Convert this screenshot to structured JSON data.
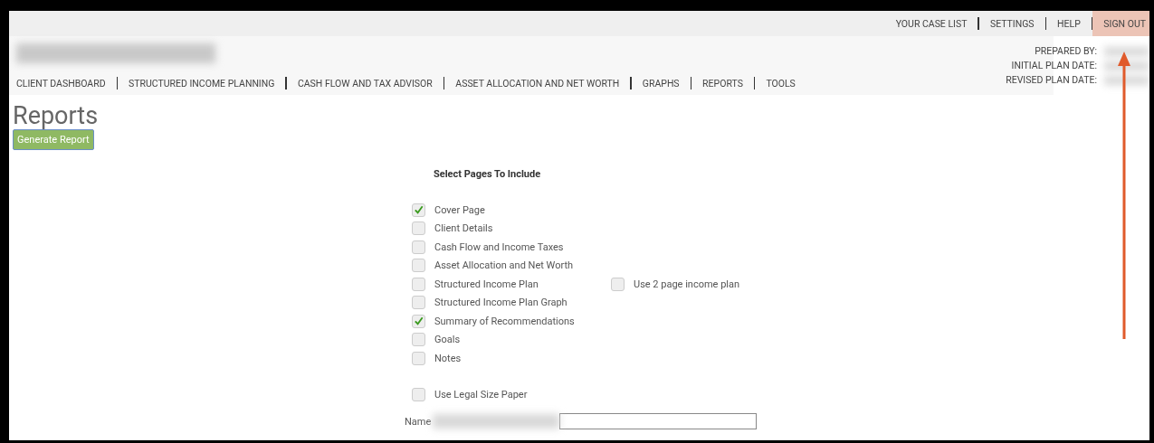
{
  "top_links": [
    {
      "label": "YOUR CASE LIST",
      "highlighted": false
    },
    {
      "label": "SETTINGS",
      "highlighted": false
    },
    {
      "label": "HELP",
      "highlighted": false
    },
    {
      "label": "SIGN OUT",
      "highlighted": true
    }
  ],
  "nav": [
    "CLIENT DASHBOARD",
    "STRUCTURED INCOME PLANNING",
    "CASH FLOW AND TAX ADVISOR",
    "ASSET ALLOCATION AND NET WORTH",
    "GRAPHS",
    "REPORTS",
    "TOOLS"
  ],
  "plan_info": [
    "PREPARED BY:",
    "INITIAL PLAN DATE:",
    "REVISED PLAN DATE:"
  ],
  "page_title": "Reports",
  "generate_button": "Generate Report",
  "section_title": "Select Pages To Include",
  "pages": [
    {
      "label": "Cover Page",
      "checked": true
    },
    {
      "label": "Client Details",
      "checked": false
    },
    {
      "label": "Cash Flow and Income Taxes",
      "checked": false
    },
    {
      "label": "Asset Allocation and Net Worth",
      "checked": false
    },
    {
      "label": "Structured Income Plan",
      "checked": false,
      "option": {
        "label": "Use 2 page income plan",
        "checked": false
      }
    },
    {
      "label": "Structured Income Plan Graph",
      "checked": false
    },
    {
      "label": "Summary of Recommendations",
      "checked": true
    },
    {
      "label": "Goals",
      "checked": false
    },
    {
      "label": "Notes",
      "checked": false
    }
  ],
  "legal_paper": {
    "label": "Use Legal Size Paper",
    "checked": false
  },
  "name_field": {
    "label": "Name"
  }
}
